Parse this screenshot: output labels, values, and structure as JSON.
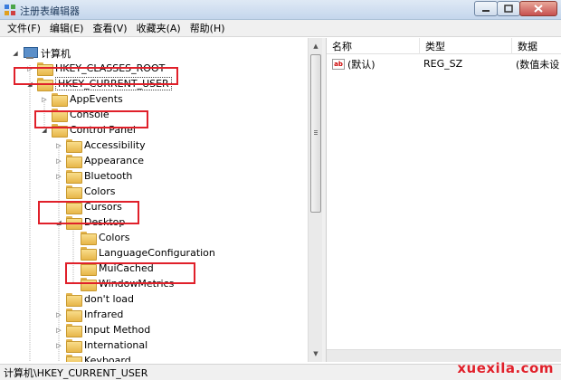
{
  "window": {
    "title": "注册表编辑器",
    "icon": "regedit-icon"
  },
  "menu": [
    "文件(F)",
    "编辑(E)",
    "查看(V)",
    "收藏夹(A)",
    "帮助(H)"
  ],
  "tree": [
    {
      "label": "计算机",
      "icon": "computer-icon",
      "expander": "collapse"
    },
    {
      "label": "HKEY_CLASSES_ROOT",
      "icon": "folder-icon",
      "expander": "expand"
    },
    {
      "label": "HKEY_CURRENT_USER",
      "icon": "folder-icon",
      "expander": "collapse",
      "selected": true
    },
    {
      "label": "AppEvents",
      "icon": "folder-icon",
      "expander": "expand"
    },
    {
      "label": "Console",
      "icon": "folder-icon",
      "expander": "none"
    },
    {
      "label": "Control Panel",
      "icon": "folder-icon",
      "expander": "collapse"
    },
    {
      "label": "Accessibility",
      "icon": "folder-icon",
      "expander": "expand"
    },
    {
      "label": "Appearance",
      "icon": "folder-icon",
      "expander": "expand"
    },
    {
      "label": "Bluetooth",
      "icon": "folder-icon",
      "expander": "expand"
    },
    {
      "label": "Colors",
      "icon": "folder-icon",
      "expander": "none"
    },
    {
      "label": "Cursors",
      "icon": "folder-icon",
      "expander": "none"
    },
    {
      "label": "Desktop",
      "icon": "folder-icon",
      "expander": "collapse"
    },
    {
      "label": "Colors",
      "icon": "folder-icon",
      "expander": "none"
    },
    {
      "label": "LanguageConfiguration",
      "icon": "folder-icon",
      "expander": "none"
    },
    {
      "label": "MuiCached",
      "icon": "folder-icon",
      "expander": "none"
    },
    {
      "label": "WindowMetrics",
      "icon": "folder-icon",
      "expander": "none"
    },
    {
      "label": "don't load",
      "icon": "folder-icon",
      "expander": "none"
    },
    {
      "label": "Infrared",
      "icon": "folder-icon",
      "expander": "expand"
    },
    {
      "label": "Input Method",
      "icon": "folder-icon",
      "expander": "expand"
    },
    {
      "label": "International",
      "icon": "folder-icon",
      "expander": "expand"
    },
    {
      "label": "Keyboard",
      "icon": "folder-icon",
      "expander": "none"
    }
  ],
  "list": {
    "columns": [
      "名称",
      "类型",
      "数据"
    ],
    "rows": [
      {
        "name": "(默认)",
        "type": "REG_SZ",
        "data": "(数值未设"
      }
    ]
  },
  "status": "计算机\\HKEY_CURRENT_USER",
  "watermark": "xuexila.com"
}
